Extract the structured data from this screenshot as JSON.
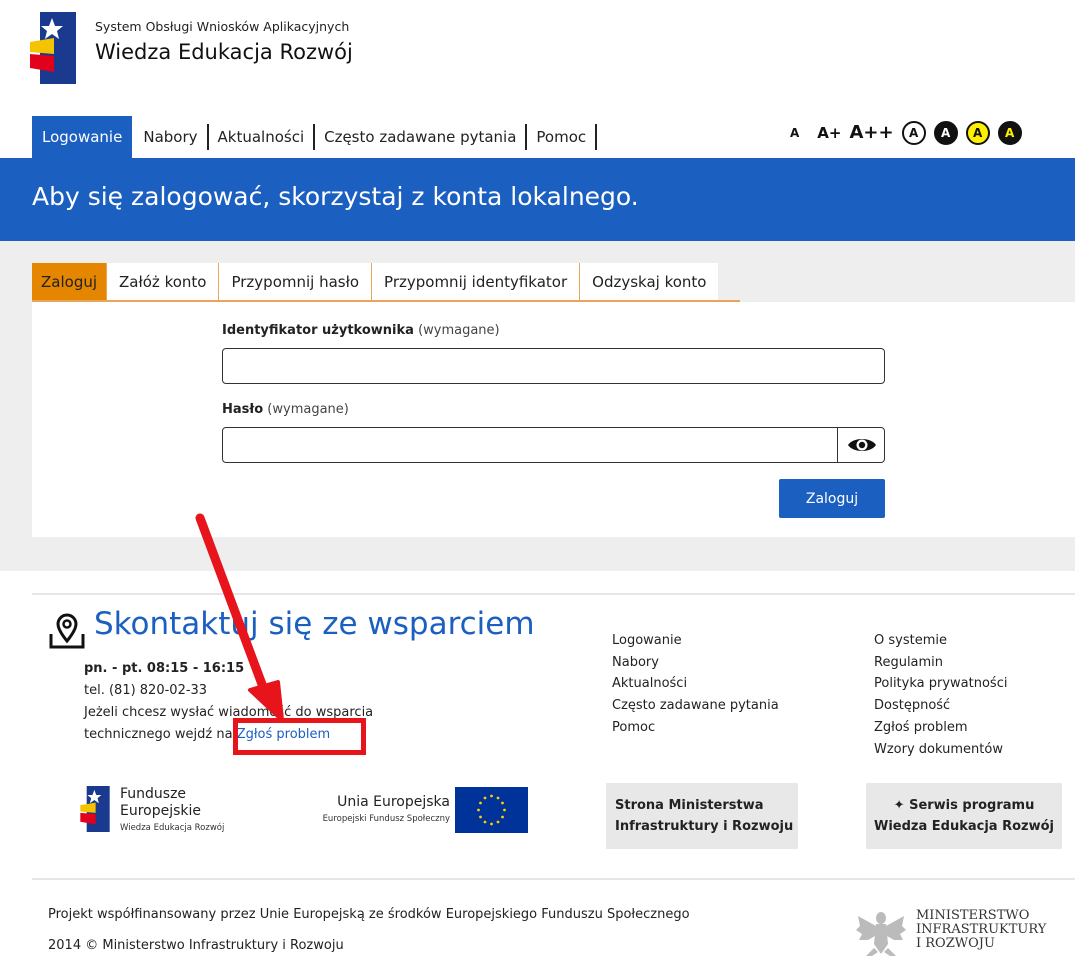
{
  "header": {
    "system_name": "System Obsługi Wniosków Aplikacyjnych",
    "program_name": "Wiedza Edukacja Rozwój"
  },
  "nav": {
    "items": [
      "Logowanie",
      "Nabory",
      "Aktualności",
      "Często zadawane pytania",
      "Pomoc"
    ],
    "active": "Logowanie"
  },
  "font_controls": {
    "sizes": [
      "A",
      "A+",
      "A++"
    ],
    "contrast": [
      "A",
      "A",
      "A",
      "A"
    ]
  },
  "banner": {
    "title": "Aby się zalogować, skorzystaj z konta lokalnego."
  },
  "auth_tabs": {
    "items": [
      "Zaloguj",
      "Załóż konto",
      "Przypomnij hasło",
      "Przypomnij identyfikator",
      "Odzyskaj konto"
    ],
    "active": "Zaloguj"
  },
  "login_form": {
    "id_label": "Identyfikator użytkownika",
    "id_required": "(wymagane)",
    "id_value": "",
    "password_label": "Hasło",
    "password_required": "(wymagane)",
    "password_value": "",
    "submit_label": "Zaloguj"
  },
  "support": {
    "title": "Skontaktuj się ze wsparciem",
    "hours": "pn. - pt. 08:15 - 16:15",
    "phone": "tel. (81) 820-02-33",
    "text_line1": "Jeżeli chcesz wysłać wiadomość do wsparcia",
    "text_line2": "technicznego wejdź na",
    "link": "Zgłoś problem"
  },
  "footer_col1": [
    "Logowanie",
    "Nabory",
    "Aktualności",
    "Często zadawane pytania",
    "Pomoc"
  ],
  "footer_col2": [
    "O systemie",
    "Regulamin",
    "Polityka prywatności",
    "Dostępność",
    "Zgłoś problem",
    "Wzory dokumentów"
  ],
  "logos": {
    "fe_line1": "Fundusze",
    "fe_line2": "Europejskie",
    "fe_sub": "Wiedza Edukacja Rozwój",
    "ue_title": "Unia Europejska",
    "ue_sub": "Europejski Fundusz Społeczny",
    "ministry_link_line1": "Strona Ministerstwa",
    "ministry_link_line2": "Infrastruktury i Rozwoju",
    "program_link_line1": "Serwis programu",
    "program_link_line2": "Wiedza Edukacja Rozwój"
  },
  "bottom": {
    "cofinance": "Projekt współfinansowany przez Unie Europejską ze środków Europejskiego Funduszu Społecznego",
    "copyright": "2014 © Ministerstwo Infrastruktury i Rozwoju",
    "ministry_line1": "MINISTERSTWO",
    "ministry_line2": "INFRASTRUKTURY",
    "ministry_line3": "I ROZWOJU"
  },
  "colors": {
    "primary_blue": "#1b5fc1",
    "tab_orange": "#e58600",
    "annotation_red": "#e8141b"
  }
}
